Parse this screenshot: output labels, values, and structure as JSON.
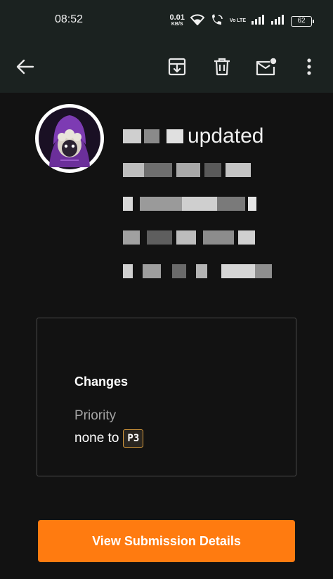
{
  "status_bar": {
    "time": "08:52",
    "net_speed_value": "0.01",
    "net_speed_unit": "KB/S",
    "volte_label": "Vo LTE",
    "battery": "62"
  },
  "toolbar": {
    "icons": [
      "back-arrow-icon",
      "archive-icon",
      "trash-icon",
      "mark-unread-icon",
      "more-vertical-icon"
    ]
  },
  "email": {
    "headline_visible_word": "updated",
    "changes_card": {
      "title": "Changes",
      "field": "Priority",
      "change_prefix": "none to",
      "badge": "P3"
    },
    "cta_label": "View Submission Details"
  },
  "colors": {
    "background": "#121212",
    "bar": "#1b2220",
    "accent": "#ff7b10",
    "badge_border": "#d79a3c"
  }
}
